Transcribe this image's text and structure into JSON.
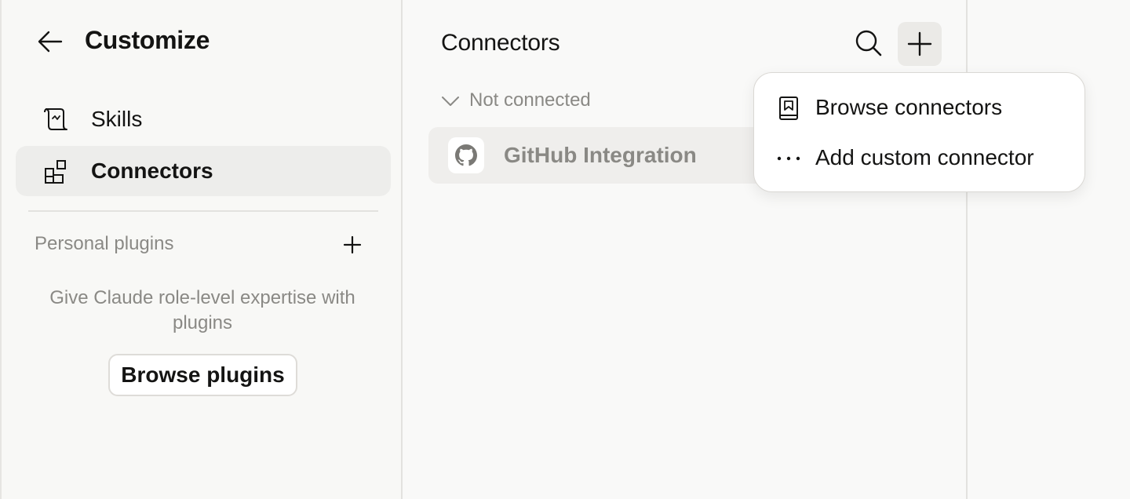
{
  "sidebar": {
    "title": "Customize",
    "back_icon": "arrow-left-icon",
    "items": [
      {
        "label": "Skills",
        "icon": "scroll-icon",
        "active": false
      },
      {
        "label": "Connectors",
        "icon": "blocks-icon",
        "active": true
      }
    ],
    "plugins": {
      "section_label": "Personal plugins",
      "empty_text": "Give Claude role-level expertise with plugins",
      "browse_label": "Browse plugins"
    }
  },
  "main": {
    "title": "Connectors",
    "search_icon": "search-icon",
    "add_icon": "plus-icon",
    "group": {
      "label": "Not connected",
      "expanded": true
    },
    "connectors": [
      {
        "name": "GitHub Integration",
        "icon": "github-icon"
      }
    ]
  },
  "menu": {
    "items": [
      {
        "label": "Browse connectors",
        "icon": "book-icon"
      },
      {
        "label": "Add custom connector",
        "icon": "more-horizontal-icon"
      }
    ]
  },
  "colors": {
    "background": "#f9f9f8",
    "text": "#141413",
    "muted": "#8a8985",
    "active_bg": "#ededeb",
    "border": "#e3e2df"
  }
}
